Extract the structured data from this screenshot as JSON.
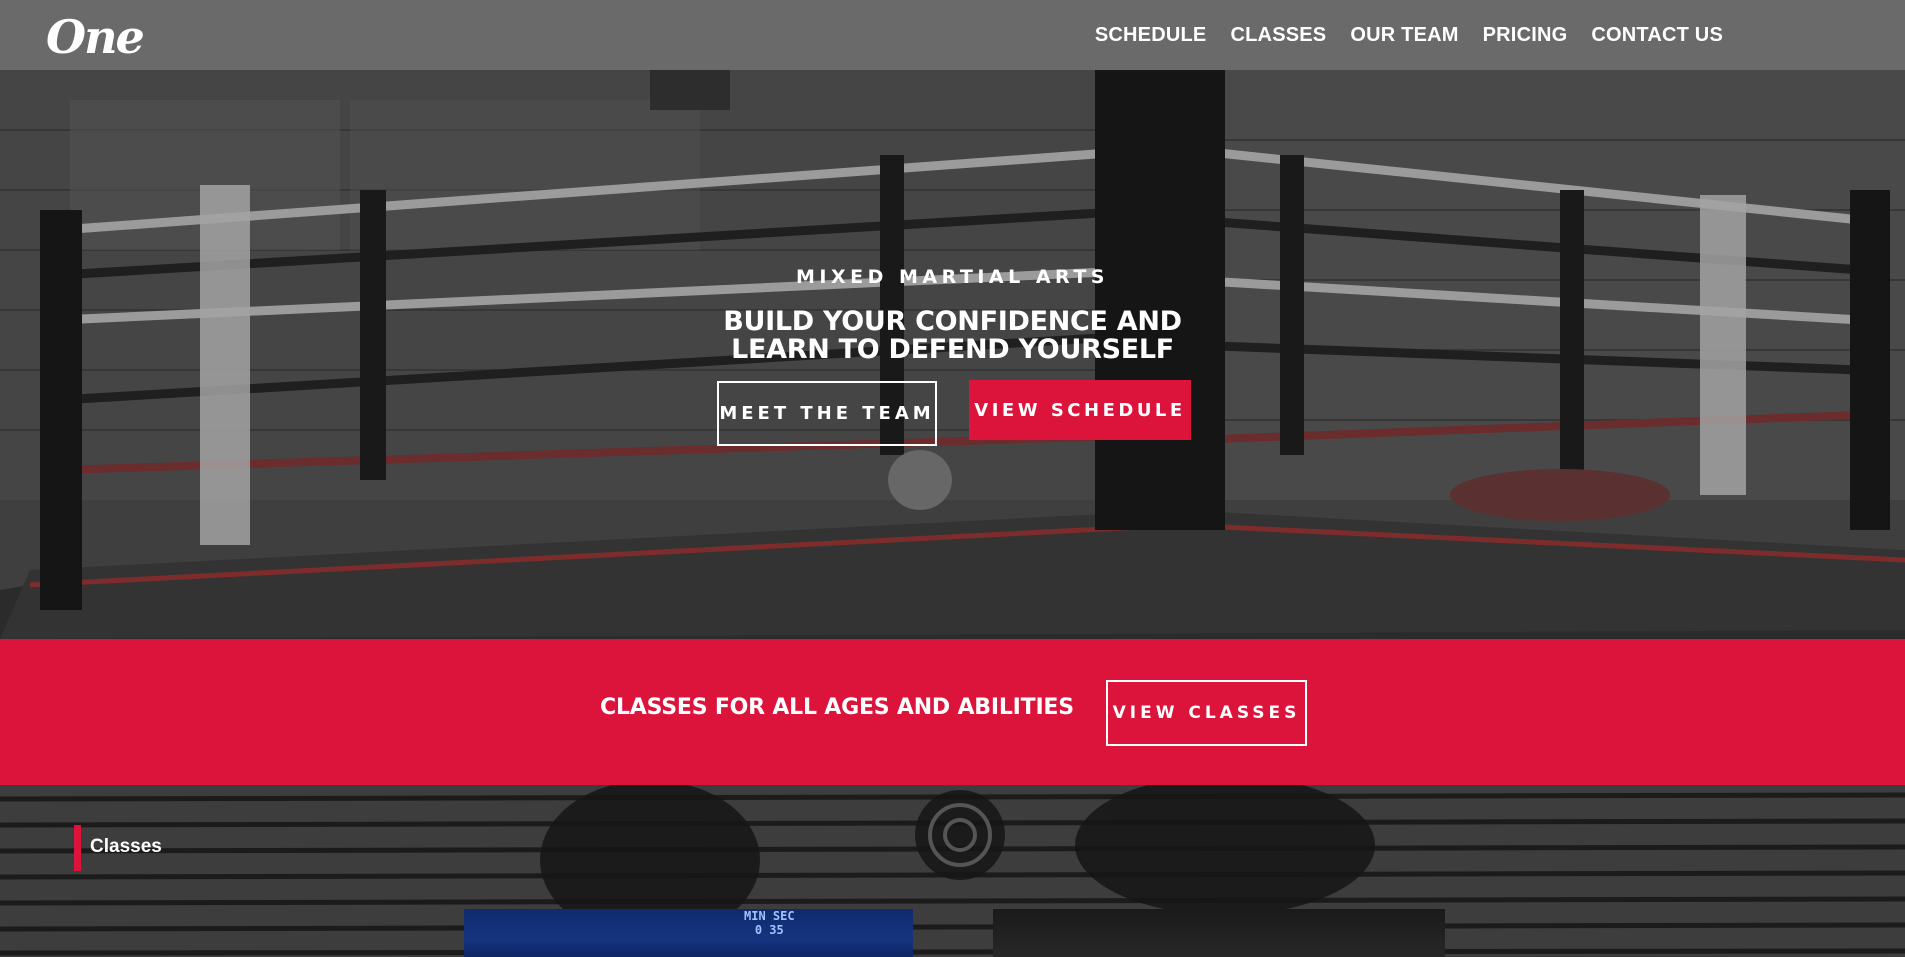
{
  "header": {
    "logo_text": "One",
    "nav": [
      "SCHEDULE",
      "CLASSES",
      "OUR TEAM",
      "PRICING",
      "CONTACT US"
    ]
  },
  "hero": {
    "kicker": "MIXED MARTIAL ARTS",
    "title_line1": "BUILD YOUR CONFIDENCE AND",
    "title_line2": "LEARN TO DEFEND YOURSELF",
    "btn_team": "MEET THE TEAM",
    "btn_schedule": "VIEW SCHEDULE"
  },
  "band": {
    "text": "CLASSES FOR ALL AGES AND ABILITIES",
    "btn": "VIEW CLASSES"
  },
  "classes_section": {
    "label": "Classes",
    "card1_scoreboard_top": "MIN  SEC",
    "card1_scoreboard_bottom": "0  35"
  },
  "colors": {
    "accent_red": "#dc143c",
    "header_gray": "#6a6a6a"
  }
}
